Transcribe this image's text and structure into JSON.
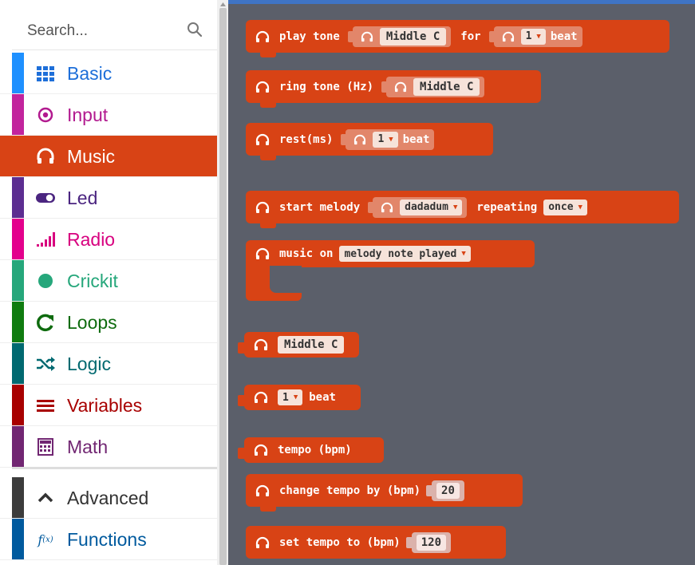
{
  "search": {
    "placeholder": "Search..."
  },
  "categories": [
    {
      "label": "Basic",
      "icon": "grid-icon",
      "color": "#1e90ff"
    },
    {
      "label": "Input",
      "icon": "target-icon",
      "color": "#c2249d"
    },
    {
      "label": "Music",
      "icon": "headphones-icon",
      "color": "#d84315",
      "selected": true
    },
    {
      "label": "Led",
      "icon": "toggle-icon",
      "color": "#5c2d91"
    },
    {
      "label": "Radio",
      "icon": "signal-bars-icon",
      "color": "#e3008c"
    },
    {
      "label": "Crickit",
      "icon": "circle-icon",
      "color": "#26a77b"
    },
    {
      "label": "Loops",
      "icon": "refresh-icon",
      "color": "#107c10"
    },
    {
      "label": "Logic",
      "icon": "shuffle-icon",
      "color": "#006970"
    },
    {
      "label": "Variables",
      "icon": "lines-icon",
      "color": "#a80000"
    },
    {
      "label": "Math",
      "icon": "calculator-icon",
      "color": "#712672"
    }
  ],
  "advanced": {
    "label": "Advanced",
    "icon": "chevron-up-icon",
    "color": "#3c3c3c"
  },
  "functions": {
    "label": "Functions",
    "icon": "function-icon",
    "color": "#005a9e"
  },
  "blocks": {
    "play_tone": {
      "prefix": "play tone",
      "note": "Middle C",
      "for": "for",
      "beat_value": "1",
      "beat": "beat"
    },
    "ring_tone": {
      "prefix": "ring tone (Hz)",
      "note": "Middle C"
    },
    "rest": {
      "prefix": "rest(ms)",
      "beat_value": "1",
      "beat": "beat"
    },
    "start_melody": {
      "prefix": "start melody",
      "melody": "dadadum",
      "repeating": "repeating",
      "mode": "once"
    },
    "music_on": {
      "prefix": "music on",
      "event": "melody note played"
    },
    "note": {
      "value": "Middle C"
    },
    "beat": {
      "value": "1",
      "label": "beat"
    },
    "tempo": {
      "label": "tempo (bpm)"
    },
    "change_tempo": {
      "prefix": "change tempo by (bpm)",
      "value": "20"
    },
    "set_tempo": {
      "prefix": "set tempo to (bpm)",
      "value": "120"
    }
  },
  "colors": {
    "music": "#d84315",
    "workspace": "#5b5f6a",
    "accent_line": "#3f74c5"
  }
}
